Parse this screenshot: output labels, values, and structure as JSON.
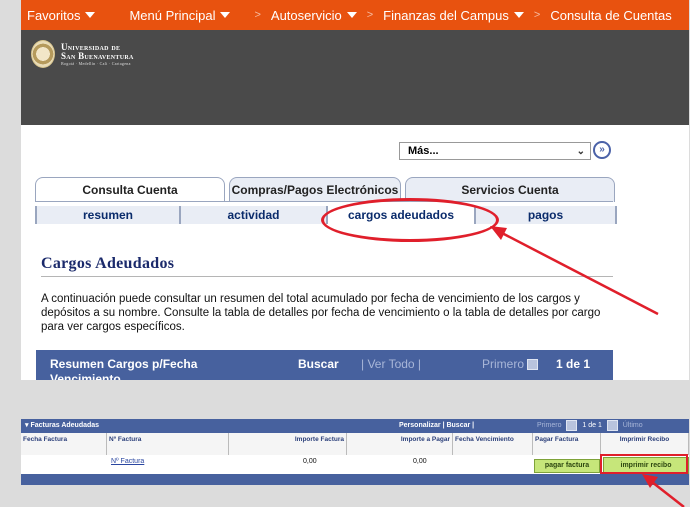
{
  "topnav": {
    "items": [
      "Favoritos",
      "Menú Principal",
      "Autoservicio",
      "Finanzas del Campus",
      "Consulta de Cuentas"
    ],
    "separator": ">"
  },
  "logo": {
    "line1": "Universidad de",
    "line2": "San Buenaventura",
    "line3": "Bogotá · Medellín · Cali · Cartagena"
  },
  "mas": {
    "value": "Más...",
    "go_label": "»"
  },
  "tabs": [
    "Consulta Cuenta",
    "Compras/Pagos Electrónicos",
    "Servicios Cuenta"
  ],
  "subtabs": [
    "resumen",
    "actividad",
    "cargos adeudados",
    "pagos"
  ],
  "page": {
    "title": "Cargos Adeudados",
    "description": "A continuación puede consultar un resumen del total acumulado por fecha de vencimiento de los cargos y depósitos a su nombre. Consulte la tabla de detalles por fecha de vencimiento o la tabla de detalles por cargo para ver cargos específicos."
  },
  "resumen": {
    "title": "Resumen Cargos p/Fecha Vencimiento",
    "buscar": "Buscar",
    "ver_todo": "| Ver Todo |",
    "primero": "Primero",
    "nav": "1 de 1"
  },
  "facturas": {
    "title": "Facturas Adeudadas",
    "personalizar": "Personalizar | Buscar |",
    "primero": "Primero",
    "nav": "1 de 1",
    "ultimo": "Último",
    "columns": [
      "Fecha Factura",
      "Nº Factura",
      "Importe Factura",
      "Importe a Pagar",
      "Fecha Vencimiento",
      "Pagar Factura",
      "Imprimir Recibo"
    ],
    "row": {
      "factura_link": "Nº Factura",
      "importe_factura": "0,00",
      "importe_pagar": "0,00",
      "pagar_button": "pagar factura",
      "imprimir_button": "imprimir recibo"
    }
  },
  "colors": {
    "nav_orange": "#e8520f",
    "header_gray": "#4a4a4a",
    "bar_blue": "#47619e",
    "highlight_red": "#e01f2b",
    "button_green": "#c6e67a"
  }
}
